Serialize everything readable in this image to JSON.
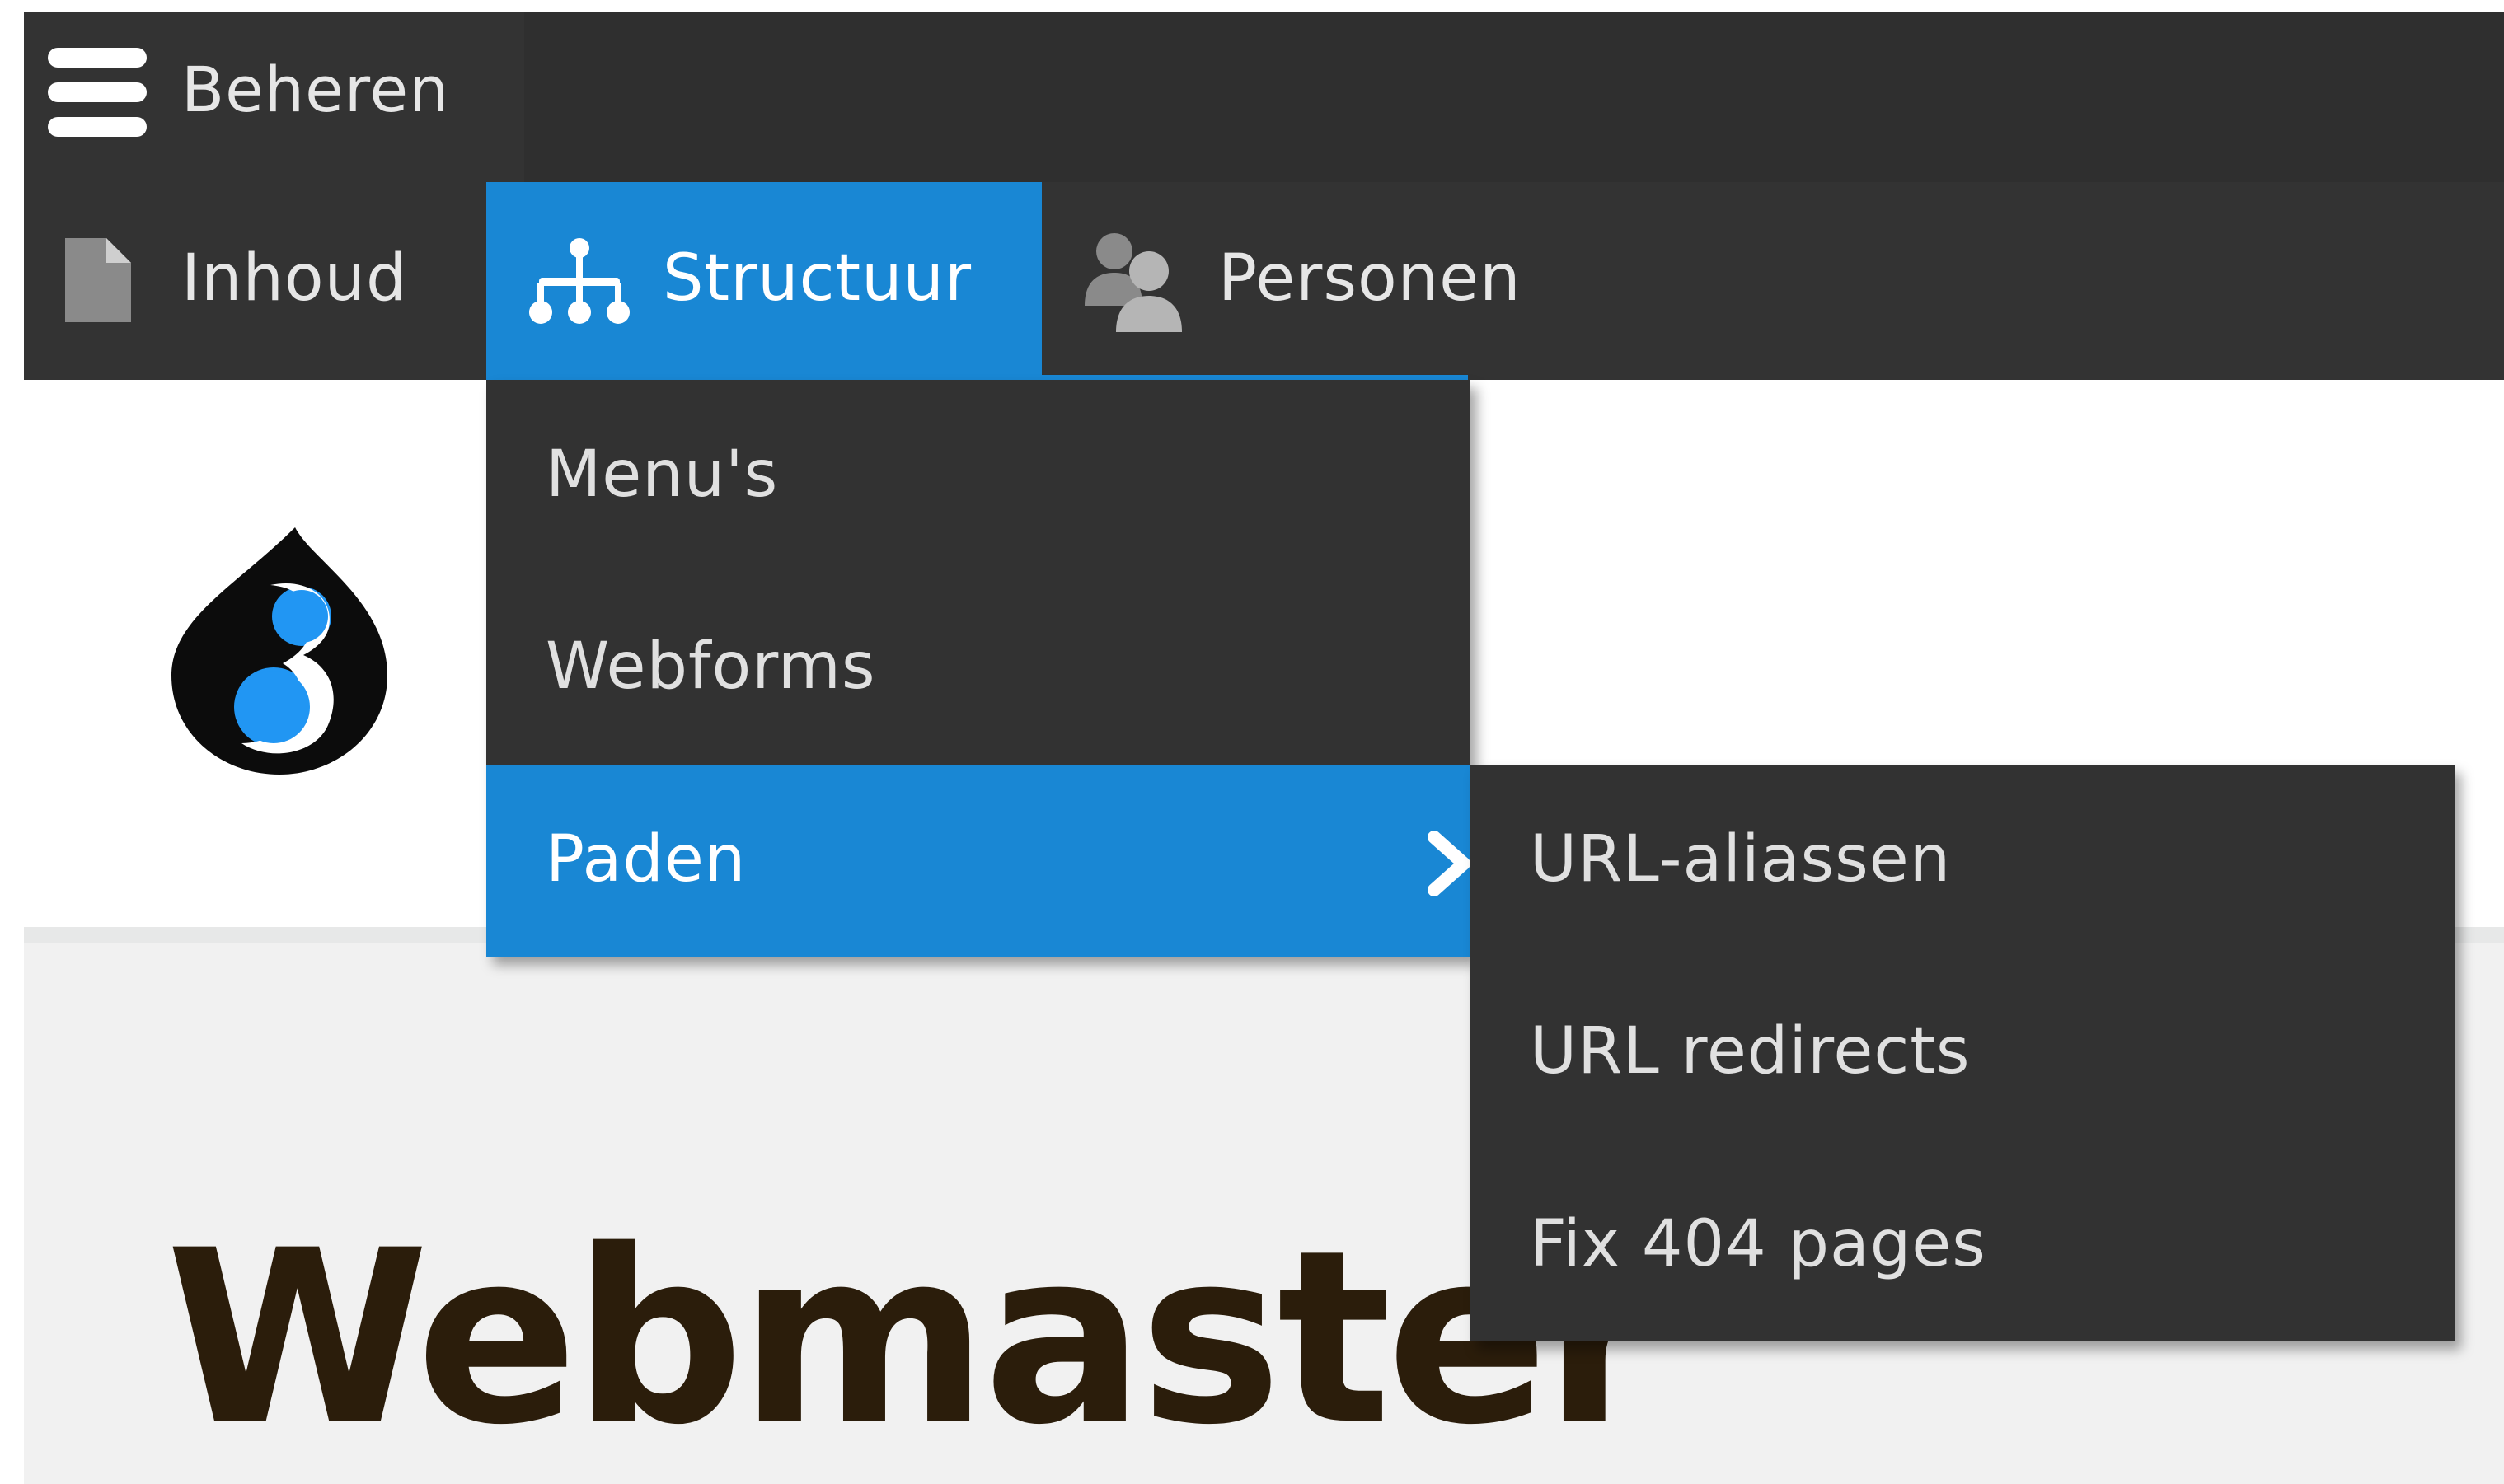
{
  "toolbar": {
    "manage_label": "Beheren",
    "tabs": [
      {
        "label": "Inhoud",
        "icon": "file-icon"
      },
      {
        "label": "Structuur",
        "icon": "sitemap-icon",
        "active": true
      },
      {
        "label": "Personen",
        "icon": "people-icon"
      }
    ]
  },
  "structure_menu": {
    "items": [
      {
        "label": "Menu's"
      },
      {
        "label": "Webforms"
      },
      {
        "label": "Paden",
        "active": true,
        "has_submenu": true
      }
    ]
  },
  "paths_submenu": {
    "items": [
      {
        "label": "URL-aliassen"
      },
      {
        "label": "URL redirects"
      },
      {
        "label": "Fix 404 pages"
      }
    ]
  },
  "site": {
    "title": "Webmaster",
    "logo": "drupal-8-logo"
  },
  "colors": {
    "toolbar_bg": "#2f2f2f",
    "tray_bg": "#333333",
    "accent": "#1987d4",
    "title": "#2b1d0b",
    "header_band": "#f1f1f1"
  }
}
